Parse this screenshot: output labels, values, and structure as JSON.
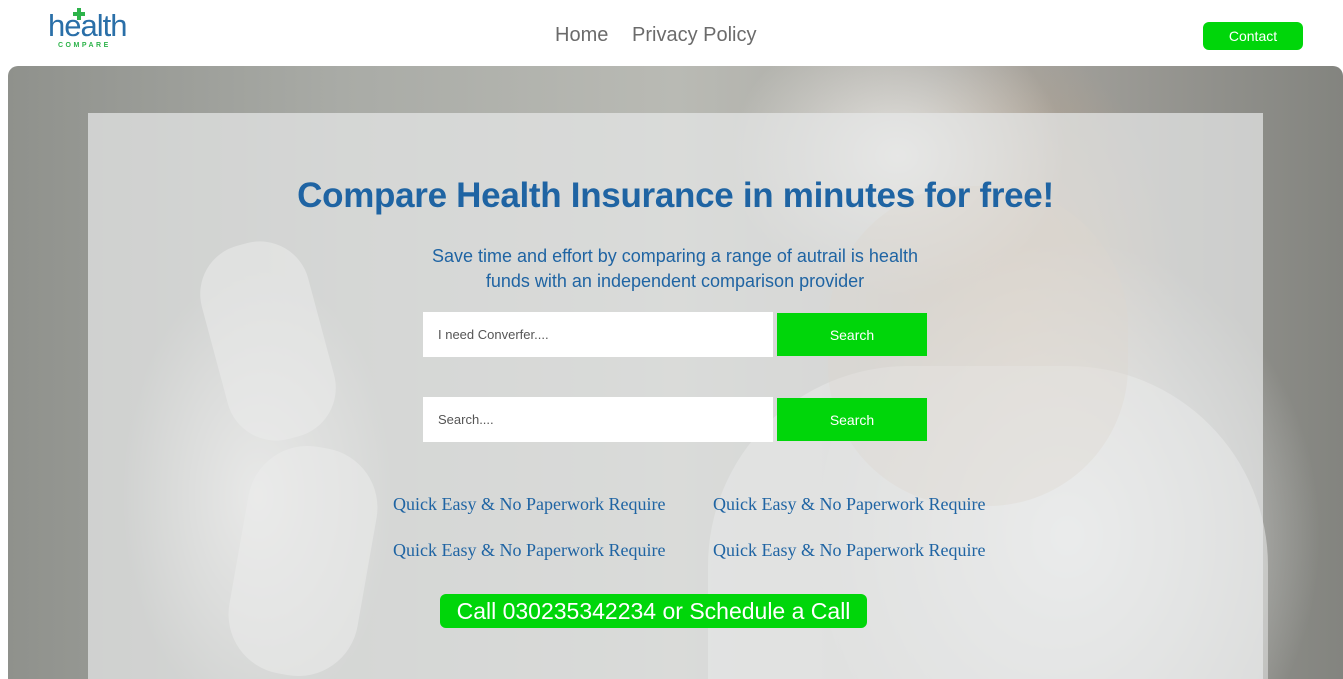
{
  "brand": {
    "logo_word": "health",
    "logo_sub": "COMPARE"
  },
  "nav": {
    "home": "Home",
    "privacy": "Privacy Policy",
    "contact": "Contact"
  },
  "hero": {
    "title": "Compare Health Insurance in minutes for free!",
    "subtitle": "Save time and effort by comparing a range of autrail is health funds with an independent comparison provider",
    "search1": {
      "placeholder": "I need Converfer....",
      "button": "Search"
    },
    "search2": {
      "placeholder": "Search....",
      "button": "Search"
    },
    "features": [
      "Quick Easy & No Paperwork Require",
      "Quick Easy & No Paperwork Require",
      "Quick Easy & No Paperwork Require",
      "Quick Easy & No Paperwork Require"
    ],
    "call_label": "Call 030235342234 or Schedule a Call"
  },
  "colors": {
    "accent_green": "#00d60a",
    "brand_blue": "#1f64a3",
    "logo_blue": "#2a6fa8",
    "logo_green": "#2db34a"
  }
}
